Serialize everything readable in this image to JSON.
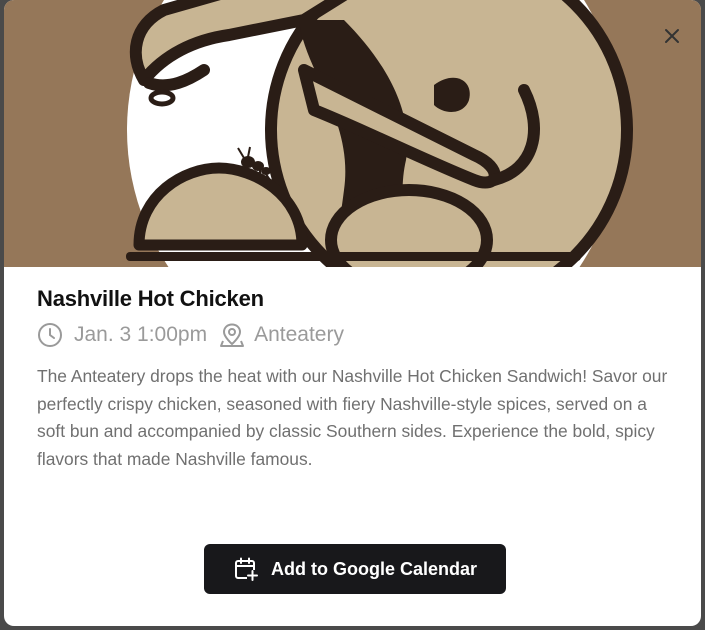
{
  "event": {
    "title": "Nashville Hot Chicken",
    "date_time": "Jan. 3 1:00pm",
    "location": "Anteatery",
    "description": "The Anteatery drops the heat with our Nashville Hot Chicken Sandwich! Savor our perfectly crispy chicken, seasoned with fiery Nashville-style spices, served on a soft bun and accompanied by classic Southern sides. Experience the bold, spicy flavors that made Nashville famous."
  },
  "actions": {
    "calendar_label": "Add to Google Calendar",
    "close_icon": "close-icon"
  },
  "icons": {
    "time": "clock-icon",
    "location": "map-pin-icon",
    "calendar": "calendar-plus-icon"
  },
  "colors": {
    "hero_background": "#957759",
    "logo_tan": "#c8b593",
    "logo_dark": "#2a1d16",
    "button_background": "#18181b",
    "meta_gray": "#9a9a9a",
    "body_gray": "#707070"
  }
}
